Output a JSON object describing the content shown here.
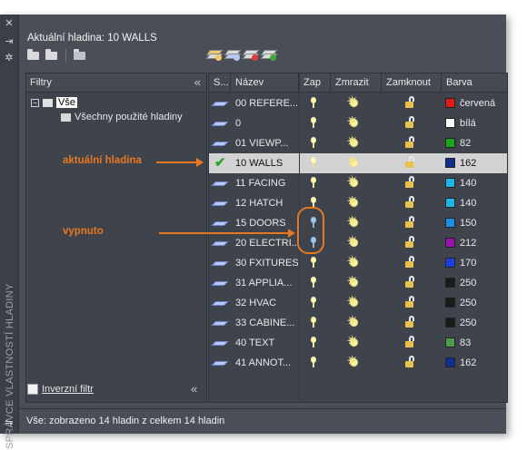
{
  "header": {
    "current_layer": "Aktuální hladina: 10 WALLS"
  },
  "side_title": "SPRÁVCE VLASTNOSTÍ HLADINY",
  "filters": {
    "header": "Filtry",
    "tree": [
      {
        "label": "Vše"
      },
      {
        "label": "Všechny použité hladiny"
      }
    ],
    "invert_label": "Inverzní filtr"
  },
  "columns": {
    "status": "S...",
    "name": "Název",
    "on": "Zap",
    "freeze": "Zmrazit",
    "lock": "Zamknout",
    "color": "Barva"
  },
  "layers": [
    {
      "name": "00 REFERE...",
      "on": true,
      "current": false,
      "color_name": "červená",
      "color_hex": "#e11b1b"
    },
    {
      "name": "0",
      "on": true,
      "current": false,
      "color_name": "bílá",
      "color_hex": "#ffffff"
    },
    {
      "name": "01 VIEWP...",
      "on": true,
      "current": false,
      "color_name": "82",
      "color_hex": "#1ea51e"
    },
    {
      "name": "10 WALLS",
      "on": true,
      "current": true,
      "color_name": "162",
      "color_hex": "#0f2f8f"
    },
    {
      "name": "11 FACING",
      "on": true,
      "current": false,
      "color_name": "140",
      "color_hex": "#19b6e8"
    },
    {
      "name": "12 HATCH",
      "on": true,
      "current": false,
      "color_name": "140",
      "color_hex": "#19b6e8"
    },
    {
      "name": "15 DOORS",
      "on": false,
      "current": false,
      "color_name": "150",
      "color_hex": "#1c8fe8"
    },
    {
      "name": "20 ELECTRI...",
      "on": false,
      "current": false,
      "color_name": "212",
      "color_hex": "#9a12a8"
    },
    {
      "name": "30 FXITURES",
      "on": true,
      "current": false,
      "color_name": "170",
      "color_hex": "#1b3fe0"
    },
    {
      "name": "31 APPLIA...",
      "on": true,
      "current": false,
      "color_name": "250",
      "color_hex": "#1a1a1a"
    },
    {
      "name": "32 HVAC",
      "on": true,
      "current": false,
      "color_name": "250",
      "color_hex": "#1a1a1a"
    },
    {
      "name": "33 CABINE...",
      "on": true,
      "current": false,
      "color_name": "250",
      "color_hex": "#1a1a1a"
    },
    {
      "name": "40 TEXT",
      "on": true,
      "current": false,
      "color_name": "83",
      "color_hex": "#4c9a4c"
    },
    {
      "name": "41 ANNOT...",
      "on": true,
      "current": false,
      "color_name": "162",
      "color_hex": "#0f2f8f"
    }
  ],
  "annotations": {
    "current": "aktuální hladina",
    "off": "vypnuto",
    "accent": "#e87722"
  },
  "status": "Vše: zobrazeno 14 hladin z celkem 14 hladin"
}
